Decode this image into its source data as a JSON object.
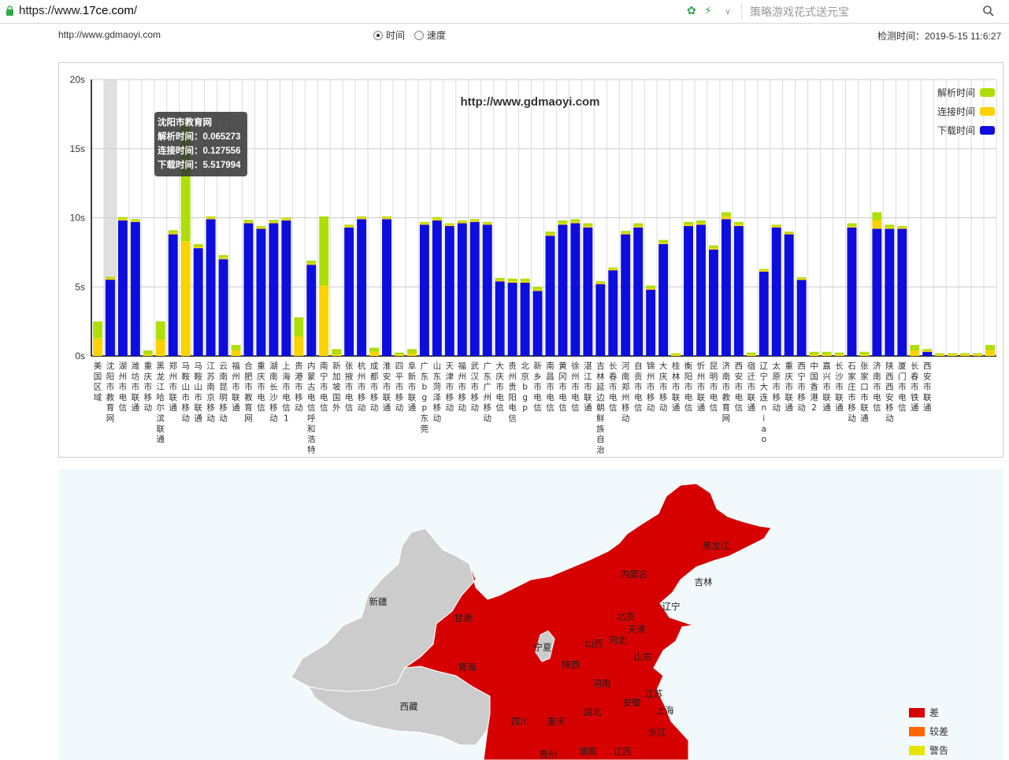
{
  "browser": {
    "url_scheme": "https://www.",
    "url_domain": "17ce.com",
    "url_path": "/",
    "search_placeholder": "策略游戏花式送元宝"
  },
  "header": {
    "target_url": "http://www.gdmaoyi.com",
    "radio_time": "时间",
    "radio_speed": "速度",
    "check_time": "检测时间：2019-5-15 11:6:27"
  },
  "tooltip": {
    "title": "沈阳市教育网",
    "dns": "解析时间：0.065273",
    "connect": "连接时间：0.127556",
    "download": "下载时间：5.517994"
  },
  "chart_data": {
    "type": "bar",
    "stacked": true,
    "title": "http://www.gdmaoyi.com",
    "ylim": [
      0,
      20
    ],
    "yticks": [
      "0s",
      "5s",
      "10s",
      "15s",
      "20s"
    ],
    "legend_position": "top-right",
    "series": [
      {
        "name": "解析时间",
        "color": "#b0de09",
        "values": [
          1.2,
          0.1,
          0.15,
          0.1,
          0.3,
          1.3,
          0.2,
          8.8,
          0.2,
          0.1,
          0.2,
          0.4,
          0.15,
          0.1,
          0.15,
          0.1,
          1.4,
          0.2,
          5.0,
          0.4,
          0.1,
          0.1,
          0.3,
          0.1,
          0.15,
          0.3,
          0.1,
          0.15,
          0.1,
          0.1,
          0.1,
          0.1,
          0.15,
          0.2,
          0.2,
          0.2,
          0.2,
          0.2,
          0.2,
          0.2,
          0.1,
          0.1,
          0.15,
          0.2,
          0.2,
          0.2,
          0.1,
          0.2,
          0.2,
          0.2,
          0.3,
          0.2,
          0.15,
          0.1,
          0.1,
          0.1,
          0.1,
          0.2,
          0.2,
          0.15,
          0.2,
          0.2,
          0.6,
          0.2,
          0.1,
          0.4,
          0.1,
          0.1,
          0.1,
          0.1,
          0.1,
          0.4
        ]
      },
      {
        "name": "连接时间",
        "color": "#fcd202",
        "values": [
          1.3,
          0.1,
          0.1,
          0.1,
          0.1,
          1.2,
          0.1,
          8.3,
          0.1,
          0.1,
          0.1,
          0.4,
          0.1,
          0.1,
          0.1,
          0.1,
          1.4,
          0.1,
          5.1,
          0.1,
          0.1,
          0.1,
          0.3,
          0.1,
          0.1,
          0.2,
          0.1,
          0.1,
          0.1,
          0.1,
          0.1,
          0.1,
          0.1,
          0.1,
          0.1,
          0.1,
          0.1,
          0.1,
          0.1,
          0.1,
          0.1,
          0.1,
          0.1,
          0.1,
          0.1,
          0.1,
          0.1,
          0.1,
          0.1,
          0.1,
          0.2,
          0.1,
          0.1,
          0.1,
          0.1,
          0.1,
          0.1,
          0.1,
          0.1,
          0.1,
          0.1,
          0.1,
          0.6,
          0.1,
          0.1,
          0.4,
          0.1,
          0.1,
          0.1,
          0.1,
          0.1,
          0.4
        ]
      },
      {
        "name": "下载时间",
        "color": "#0d0dde",
        "values": [
          0,
          5.52,
          9.8,
          9.7,
          0,
          0,
          8.8,
          0,
          7.8,
          9.9,
          7.0,
          0,
          9.6,
          9.2,
          9.6,
          9.8,
          0,
          6.6,
          0,
          0,
          9.3,
          9.9,
          0,
          9.9,
          0,
          0,
          9.5,
          9.8,
          9.4,
          9.6,
          9.7,
          9.5,
          5.4,
          5.3,
          5.3,
          4.7,
          8.7,
          9.5,
          9.6,
          9.3,
          5.2,
          6.2,
          8.8,
          9.3,
          4.8,
          8.1,
          0,
          9.4,
          9.5,
          7.7,
          9.9,
          9.4,
          0,
          6.1,
          9.3,
          8.8,
          5.5,
          0,
          0,
          0,
          9.3,
          0,
          9.2,
          9.2,
          9.2,
          0,
          0.3,
          0,
          0,
          0,
          0,
          0
        ]
      }
    ],
    "categories": [
      "美国区域",
      "沈阳市教育网",
      "湖州市电信",
      "潍坊市联通",
      "重庆市移动",
      "黑龙江哈尔滨联通",
      "郑州市联通",
      "马鞍山市移动",
      "马鞍山市联通",
      "江苏南京移动",
      "云南昆明移动",
      "福州市联通",
      "合肥市教育网",
      "重庆市电信",
      "湖南长沙移动",
      "上海市电信1",
      "贵港市移动",
      "内蒙古电信呼和浩特",
      "南宁市电信",
      "新加坡国外",
      "张掖市电信",
      "杭州市移动",
      "成都市移动",
      "淮安市联通",
      "四平市移动",
      "阜新市联通",
      "广东bgp东莞",
      "山东菏泽移动",
      "天津市移动",
      "福州市移动",
      "武汉市移动",
      "广东广州移动",
      "大庆市电信",
      "贵州贵阳电信",
      "北京bgp",
      "新乡市电信",
      "南昌市电信",
      "黄冈市电信",
      "徐州市电信",
      "湛江市联通",
      "吉林延边朝鲜族自治",
      "长春市电信",
      "河南郑州移动",
      "自贡市电信",
      "锦州市移动",
      "大庆市移动",
      "桂林市联通",
      "衡阳市电信",
      "忻州市联通",
      "昆明市电信",
      "济南市教育网",
      "西安市电信",
      "宿迁市联通",
      "辽宁大连niao",
      "太原市移动",
      "重庆市联通",
      "西宁市移动",
      "中国香港2",
      "嘉兴市联通",
      "长沙市联通",
      "石家庄市移动",
      "张家口市联通",
      "济南市电信",
      "陕西西安移动",
      "厦门市电信",
      "长春市铁通",
      "西安市联通",
      "",
      "",
      "",
      "",
      ""
    ],
    "highlight_index": 1
  },
  "map": {
    "provinces": [
      "新疆",
      "西藏",
      "甘肃",
      "青海",
      "宁夏",
      "内蒙古",
      "黑龙江",
      "吉林",
      "辽宁",
      "北京",
      "天津",
      "河北",
      "山西",
      "陕西",
      "山东",
      "河南",
      "江苏",
      "安徽",
      "上海",
      "湖北",
      "四川",
      "重庆",
      "浙江",
      "湖南",
      "江西",
      "贵州"
    ],
    "legend": [
      {
        "label": "差",
        "color": "#d60000"
      },
      {
        "label": "较差",
        "color": "#ff6600"
      },
      {
        "label": "警告",
        "color": "#e5e500"
      }
    ]
  }
}
